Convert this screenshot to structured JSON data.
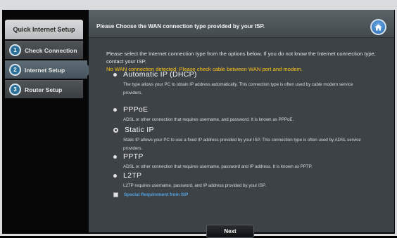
{
  "sidebar": {
    "title": "Quick Internet Setup",
    "items": [
      {
        "num": "1",
        "label": "Check Connection"
      },
      {
        "num": "2",
        "label": "Internet Setup"
      },
      {
        "num": "3",
        "label": "Router Setup"
      }
    ]
  },
  "main": {
    "title": "Please Choose the WAN connection type provided by your ISP.",
    "intro": "Please select the Internet connection type from the options below. If you do not know the Internet connection type, contact your ISP.",
    "warning": "No WAN connection detected. Please check cable between WAN port and modem.",
    "options": [
      {
        "label": "Automatic IP (DHCP)",
        "desc": "The type allows your PC to obtain IP address automatically. This connection type is often used by cable modem service providers."
      },
      {
        "label": "PPPoE",
        "desc": "ADSL or other connection that requires username, and password. It is known as PPPoE."
      },
      {
        "label": "Static IP",
        "desc": "Static IP allows your PC to use a fixed IP address provided by your ISP. This connection type is often used by ADSL service providers."
      },
      {
        "label": "PPTP",
        "desc": "ADSL or other connection that requires username, password and IP address. It is known as PPTP."
      },
      {
        "label": "L2TP",
        "desc": "L2TP requires username, password, and IP address provided by your ISP."
      }
    ],
    "special_label": "Special Requirement from ISP",
    "next_label": "Next"
  },
  "icons": {
    "home": "home-icon"
  },
  "colors": {
    "warning": "#ffc21a",
    "link": "#52a3e2",
    "accent": "#2a6f98"
  }
}
